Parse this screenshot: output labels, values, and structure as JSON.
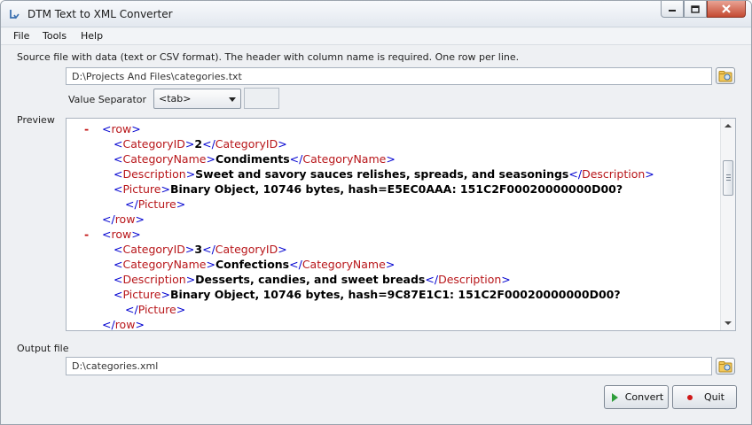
{
  "window": {
    "title": "DTM Text to XML Converter",
    "controls": {
      "minimize_icon": "minimize-icon",
      "maximize_icon": "maximize-icon",
      "close_icon": "close-icon"
    }
  },
  "menu": {
    "items": [
      "File",
      "Tools",
      "Help"
    ]
  },
  "source": {
    "label": "Source file with data (text or CSV format). The header with column name is required. One row per line.",
    "path": "D:\\Projects And Files\\categories.txt",
    "browse_icon": "folder-browse-icon"
  },
  "separator": {
    "label": "Value Separator",
    "selected": "<tab>"
  },
  "preview": {
    "label": "Preview",
    "lines": [
      {
        "indent": 0,
        "dash": "-",
        "open": "row",
        "close": "",
        "value": ""
      },
      {
        "indent": 1,
        "dash": "",
        "open": "CategoryID",
        "close": "CategoryID",
        "value": "2"
      },
      {
        "indent": 1,
        "dash": "",
        "open": "CategoryName",
        "close": "CategoryName",
        "value": "Condiments"
      },
      {
        "indent": 1,
        "dash": "",
        "open": "Description",
        "close": "Description",
        "value": "Sweet and savory sauces relishes, spreads, and seasonings"
      },
      {
        "indent": 1,
        "dash": "",
        "open": "Picture",
        "close": "",
        "value": "Binary Object, 10746 bytes, hash=E5EC0AAA: 151C2F00020000000D00?"
      },
      {
        "indent": 2,
        "dash": "",
        "open": "",
        "close": "Picture",
        "value": ""
      },
      {
        "indent": 0,
        "dash": "",
        "open": "",
        "close": "row",
        "value": ""
      },
      {
        "indent": 0,
        "dash": "-",
        "open": "row",
        "close": "",
        "value": ""
      },
      {
        "indent": 1,
        "dash": "",
        "open": "CategoryID",
        "close": "CategoryID",
        "value": "3"
      },
      {
        "indent": 1,
        "dash": "",
        "open": "CategoryName",
        "close": "CategoryName",
        "value": "Confections"
      },
      {
        "indent": 1,
        "dash": "",
        "open": "Description",
        "close": "Description",
        "value": "Desserts, candies, and sweet breads"
      },
      {
        "indent": 1,
        "dash": "",
        "open": "Picture",
        "close": "",
        "value": "Binary Object, 10746 bytes, hash=9C87E1C1: 151C2F00020000000D00?"
      },
      {
        "indent": 2,
        "dash": "",
        "open": "",
        "close": "Picture",
        "value": ""
      },
      {
        "indent": 0,
        "dash": "",
        "open": "",
        "close": "row",
        "value": ""
      }
    ]
  },
  "output": {
    "label": "Output file",
    "path": "D:\\categories.xml",
    "browse_icon": "folder-browse-icon"
  },
  "buttons": {
    "convert": {
      "label": "Convert",
      "icon": "play-icon",
      "color": "#2e9e3a"
    },
    "quit": {
      "label": "Quit",
      "icon": "stop-dot-icon",
      "color": "#d01818"
    }
  }
}
